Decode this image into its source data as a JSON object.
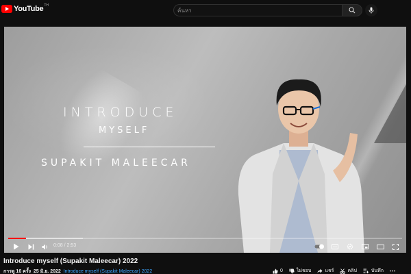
{
  "header": {
    "logo_text": "YouTube",
    "logo_country": "TH",
    "search_placeholder": "ค้นหา"
  },
  "video_overlay": {
    "line1": "INTRODUCE",
    "line2": "MYSELF",
    "line3": "SUPAKIT MALEECAR"
  },
  "player": {
    "time_current": "0:08",
    "time_separator": " / ",
    "time_total": "2:53",
    "played_fraction": 0.046,
    "loaded_fraction": 0.19,
    "colors": {
      "played": "#ff0000",
      "accent": "#3ea6ff"
    }
  },
  "video": {
    "title": "Introduce myself (Supakit Maleecar) 2022",
    "views": "การดู 16 ครั้ง",
    "date": "25 มิ.ย. 2022",
    "description_link": "Introduce myself (Supakit Maleecar) 2022"
  },
  "actions": {
    "like_count": "0",
    "dislike_label": "ไม่ชอบ",
    "share_label": "แชร์",
    "clip_label": "คลิป",
    "save_label": "บันทึก"
  },
  "icons": [
    "youtube-logo-icon",
    "search-icon",
    "mic-icon",
    "play-icon",
    "next-icon",
    "volume-icon",
    "autoplay-toggle-icon",
    "subtitles-icon",
    "settings-icon",
    "miniplayer-icon",
    "theater-icon",
    "fullscreen-icon",
    "like-icon",
    "dislike-icon",
    "share-icon",
    "clip-icon",
    "save-icon",
    "more-icon"
  ]
}
